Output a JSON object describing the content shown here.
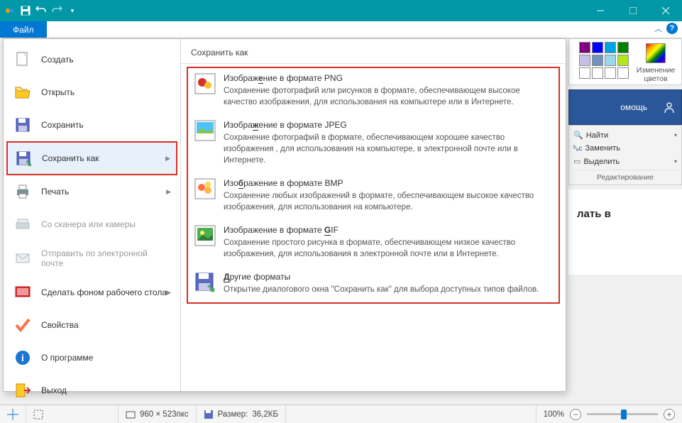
{
  "titlebar": {
    "qat": [
      "paint-icon",
      "save-icon",
      "undo-icon",
      "redo-icon",
      "dropdown-icon"
    ]
  },
  "ribbon": {
    "file_tab": "Файл"
  },
  "backstage": {
    "items": [
      {
        "label": "Создать"
      },
      {
        "label": "Открыть"
      },
      {
        "label": "Сохранить"
      },
      {
        "label": "Сохранить как"
      },
      {
        "label": "Печать"
      },
      {
        "label": "Со сканера или камеры"
      },
      {
        "label": "Отправить по электронной почте"
      },
      {
        "label": "Сделать фоном рабочего стола"
      },
      {
        "label": "Свойства"
      },
      {
        "label": "О программе"
      },
      {
        "label": "Выход"
      }
    ],
    "right_title": "Сохранить как",
    "formats": [
      {
        "title_pre": "Изображ",
        "title_u": "е",
        "title_post": "ние в формате PNG",
        "desc": "Сохранение фотографий или рисунков в формате, обеспечивающем высокое качество изображения, для использования на компьютере или в Интернете."
      },
      {
        "title_pre": "Изобра",
        "title_u": "ж",
        "title_post": "ение в формате JPEG",
        "desc": "Сохранение фотографий в формате, обеспечивающем хорошее качество изображения , для использования на компьютере, в электронной почте или в Интернете."
      },
      {
        "title_pre": "Изо",
        "title_u": "б",
        "title_post": "ражение в формате BMP",
        "desc": "Сохранение любых изображений в формате, обеспечивающем высокое качество изображения, для использования на компьютере."
      },
      {
        "title_pre": "Изображение в формате ",
        "title_u": "G",
        "title_post": "IF",
        "desc": "Сохранение простого рисунка в формате, обеспечивающем низкое качество изображения, для использования в электронной почте или в Интернете."
      },
      {
        "title_pre": "",
        "title_u": "Д",
        "title_post": "ругие форматы",
        "desc": "Открытие диалогового окна \"Сохранить как\" для выбора доступных типов файлов."
      }
    ]
  },
  "right_ui": {
    "color_edit": "Изменение цветов",
    "word_help": "омощь",
    "find": "Найти",
    "replace": "Заменить",
    "select": "Выделить",
    "editing": "Редактирование",
    "doc_text": "лать в"
  },
  "statusbar": {
    "dims": "960 × 523пкс",
    "size_label": "Размер:",
    "size_val": "36,2КБ",
    "zoom": "100%"
  },
  "colors": {
    "swatches": [
      "#800080",
      "#0000ff",
      "#00a2e8",
      "#008000",
      "#808080",
      "#4040c0",
      "#4080ff",
      "#a349a4",
      "#ffffff",
      "#c0c0c0",
      "#b97a57",
      "#ffaec9"
    ]
  }
}
